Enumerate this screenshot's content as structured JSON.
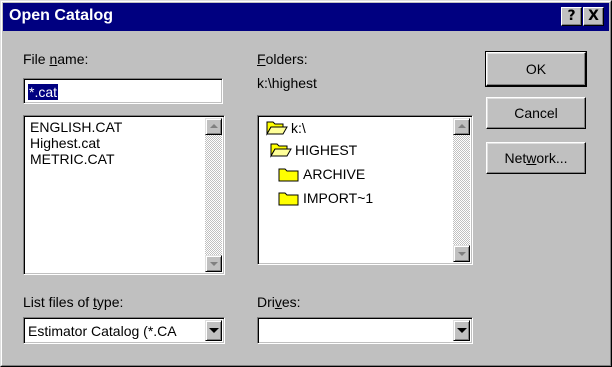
{
  "window": {
    "title": "Open Catalog",
    "help_glyph": "?",
    "close_glyph": "X"
  },
  "file_name": {
    "label_pre": "File ",
    "label_accel": "n",
    "label_post": "ame:",
    "value": "*.cat",
    "files": [
      "ENGLISH.CAT",
      "Highest.cat",
      "METRIC.CAT"
    ]
  },
  "folders": {
    "label_accel": "F",
    "label_post": "olders:",
    "current_path": "k:\\highest",
    "items": [
      {
        "label": "k:\\",
        "icon": "open-folder-icon"
      },
      {
        "label": "HIGHEST",
        "icon": "open-folder-icon"
      },
      {
        "label": "ARCHIVE",
        "icon": "closed-folder-icon"
      },
      {
        "label": "IMPORT~1",
        "icon": "closed-folder-icon"
      }
    ]
  },
  "file_type": {
    "label_pre": "List files of ",
    "label_accel": "t",
    "label_post": "ype:",
    "value": "Estimator Catalog (*.CA"
  },
  "drives": {
    "label_pre": "Dri",
    "label_accel": "v",
    "label_post": "es:",
    "value": ""
  },
  "buttons": {
    "ok": "OK",
    "cancel": "Cancel",
    "network_pre": "Net",
    "network_accel": "w",
    "network_post": "ork..."
  },
  "colors": {
    "titlebar": "#000080",
    "face": "#c0c0c0",
    "selection": "#000080",
    "folder_fill": "#ffff00"
  }
}
